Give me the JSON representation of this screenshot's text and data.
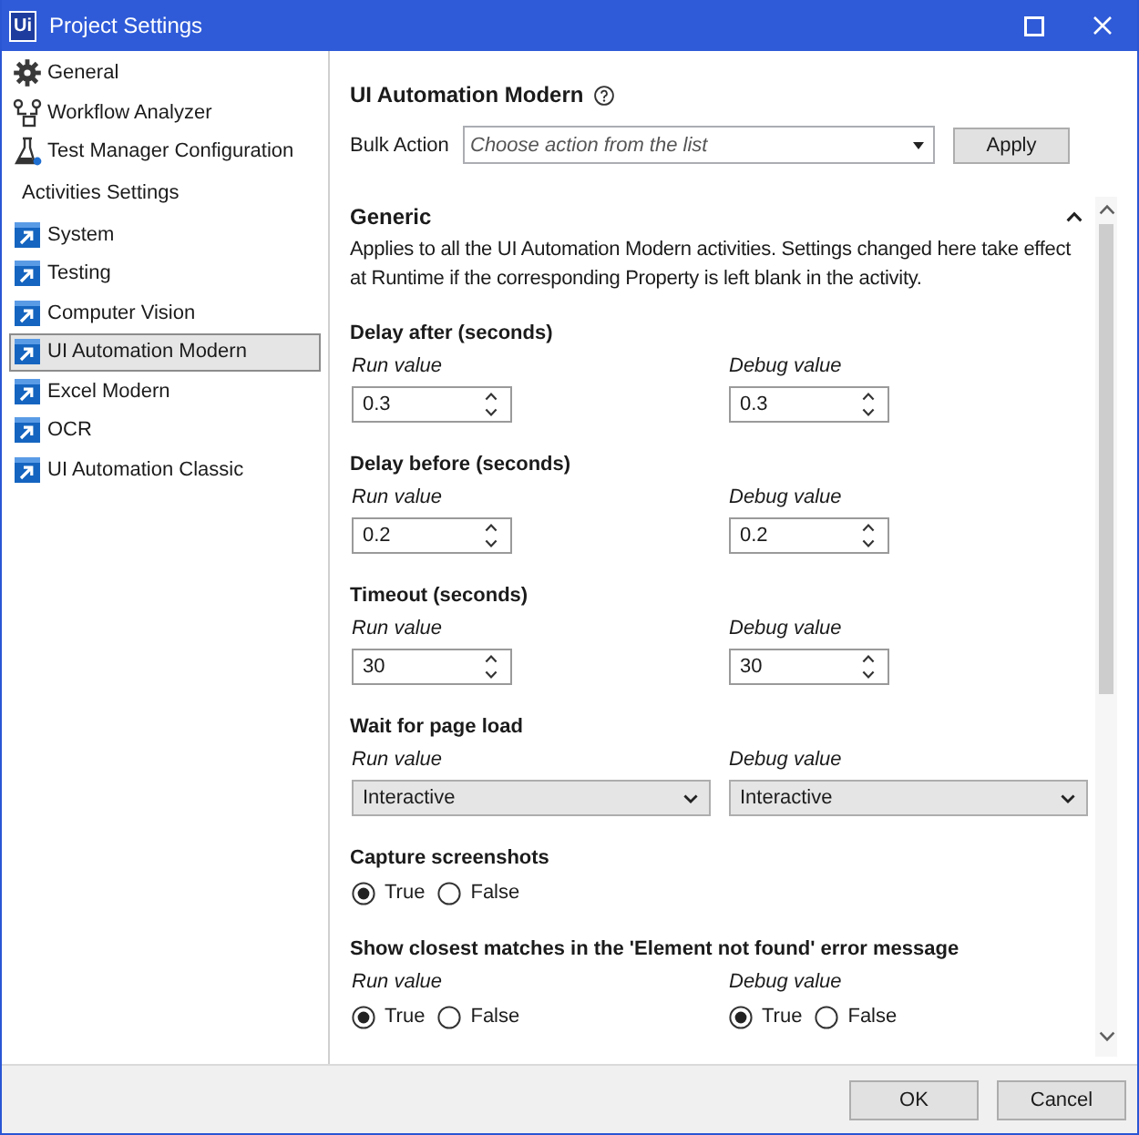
{
  "window": {
    "logo": "Ui",
    "title": "Project Settings"
  },
  "sidebar": {
    "items": [
      {
        "label": "General",
        "selected": false
      },
      {
        "label": "Workflow Analyzer",
        "selected": false
      },
      {
        "label": "Test Manager Configuration",
        "selected": false
      }
    ],
    "section_title": "Activities Settings",
    "activities": [
      {
        "label": "System",
        "selected": false
      },
      {
        "label": "Testing",
        "selected": false
      },
      {
        "label": "Computer Vision",
        "selected": false
      },
      {
        "label": "UI Automation Modern",
        "selected": true
      },
      {
        "label": "Excel Modern",
        "selected": false
      },
      {
        "label": "OCR",
        "selected": false
      },
      {
        "label": "UI Automation Classic",
        "selected": false
      }
    ]
  },
  "main": {
    "title": "UI Automation Modern",
    "bulk_action": {
      "label": "Bulk Action",
      "placeholder": "Choose action from the list",
      "button": "Apply"
    },
    "group": {
      "title": "Generic",
      "expanded": true,
      "description": "Applies to all the UI Automation Modern activities. Settings changed here take effect at Runtime if the corresponding Property is left blank in the activity."
    },
    "settings": [
      {
        "kind": "number",
        "title": "Delay after (seconds)",
        "run": {
          "label": "Run value",
          "value": "0.3"
        },
        "debug": {
          "label": "Debug value",
          "value": "0.3"
        }
      },
      {
        "kind": "number",
        "title": "Delay before (seconds)",
        "run": {
          "label": "Run value",
          "value": "0.2"
        },
        "debug": {
          "label": "Debug value",
          "value": "0.2"
        }
      },
      {
        "kind": "number",
        "title": "Timeout (seconds)",
        "run": {
          "label": "Run value",
          "value": "30"
        },
        "debug": {
          "label": "Debug value",
          "value": "30"
        }
      },
      {
        "kind": "select",
        "title": "Wait for page load",
        "run": {
          "label": "Run value",
          "value": "Interactive"
        },
        "debug": {
          "label": "Debug value",
          "value": "Interactive"
        }
      },
      {
        "kind": "radio",
        "title": "Capture screenshots",
        "run": {
          "options": [
            {
              "label": "True",
              "selected": true
            },
            {
              "label": "False",
              "selected": false
            }
          ]
        }
      },
      {
        "kind": "radio",
        "title": "Show closest matches in the 'Element not found' error message",
        "run": {
          "label": "Run value",
          "options": [
            {
              "label": "True",
              "selected": true
            },
            {
              "label": "False",
              "selected": false
            }
          ]
        },
        "debug": {
          "label": "Debug value",
          "options": [
            {
              "label": "True",
              "selected": true
            },
            {
              "label": "False",
              "selected": false
            }
          ]
        }
      }
    ]
  },
  "buttons": [
    {
      "label": "OK"
    },
    {
      "label": "Cancel"
    }
  ]
}
